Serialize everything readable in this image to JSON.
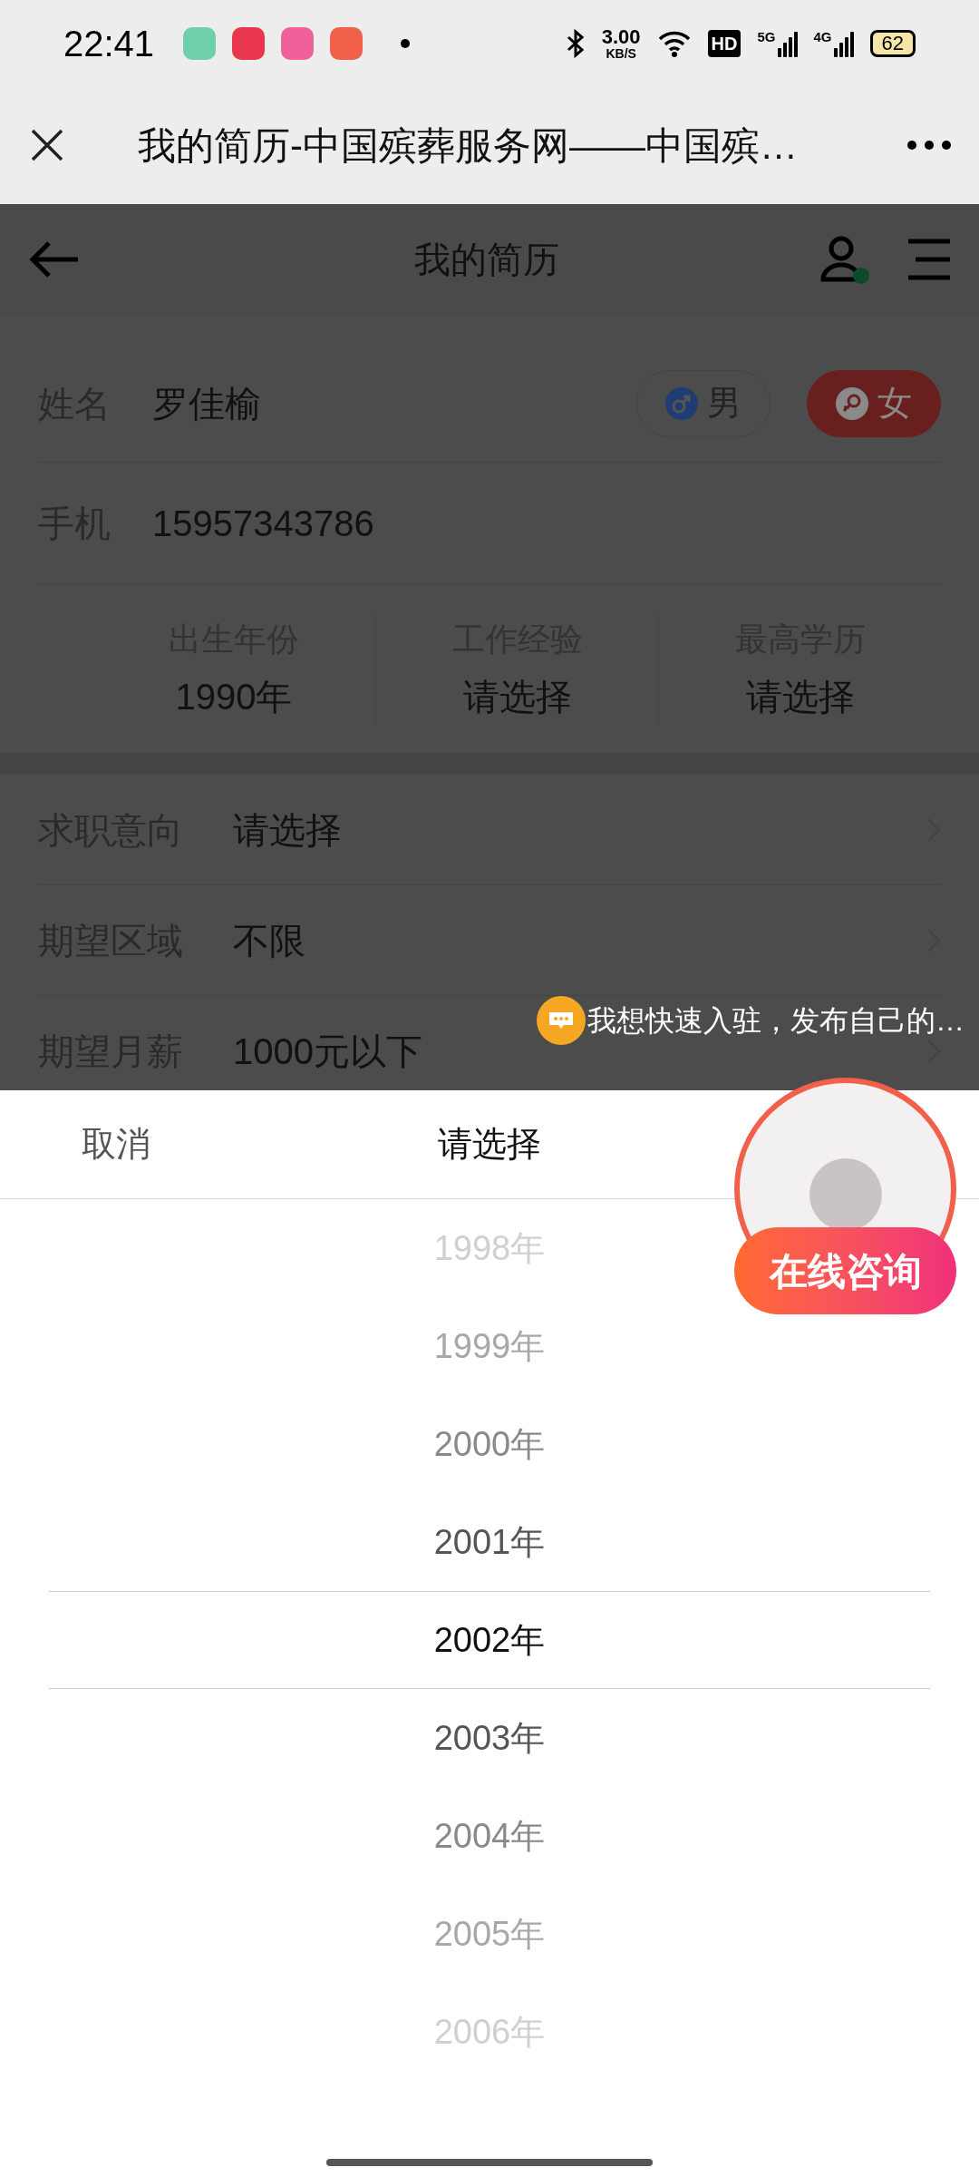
{
  "status_bar": {
    "time": "22:41",
    "app_icons": [
      {
        "color": "#6fd0ab"
      },
      {
        "color": "#e8364f"
      },
      {
        "color": "#f0609a"
      },
      {
        "color": "#f0604a"
      }
    ],
    "net_speed_value": "3.00",
    "net_speed_unit": "KB/S",
    "hd_badge": "HD",
    "signal_5g": "5G",
    "signal_4g": "4G",
    "battery": "62"
  },
  "browser_bar": {
    "title": "我的简历-中国殡葬服务网——中国殡…"
  },
  "page_header": {
    "title": "我的简历"
  },
  "profile": {
    "name_label": "姓名",
    "name_value": "罗佳榆",
    "genders": [
      {
        "kind": "male",
        "label": "男",
        "selected": false
      },
      {
        "kind": "female",
        "label": "女",
        "selected": true
      }
    ],
    "phone_label": "手机",
    "phone_value": "15957343786",
    "stats": [
      {
        "label": "出生年份",
        "value": "1990年"
      },
      {
        "label": "工作经验",
        "value": "请选择"
      },
      {
        "label": "最高学历",
        "value": "请选择"
      }
    ]
  },
  "preferences": [
    {
      "label": "求职意向",
      "value": "请选择"
    },
    {
      "label": "期望区域",
      "value": "不限"
    },
    {
      "label": "期望月薪",
      "value": "1000元以下"
    }
  ],
  "chat_tip": "我想快速入驻，发布自己的…",
  "consult_button": "在线咨询",
  "picker": {
    "cancel": "取消",
    "title": "请选择",
    "options": [
      {
        "label": "1998年",
        "selected": false
      },
      {
        "label": "1999年",
        "selected": false
      },
      {
        "label": "2000年",
        "selected": false
      },
      {
        "label": "2001年",
        "selected": false
      },
      {
        "label": "2002年",
        "selected": true
      },
      {
        "label": "2003年",
        "selected": false
      },
      {
        "label": "2004年",
        "selected": false
      },
      {
        "label": "2005年",
        "selected": false
      },
      {
        "label": "2006年",
        "selected": false
      }
    ]
  }
}
